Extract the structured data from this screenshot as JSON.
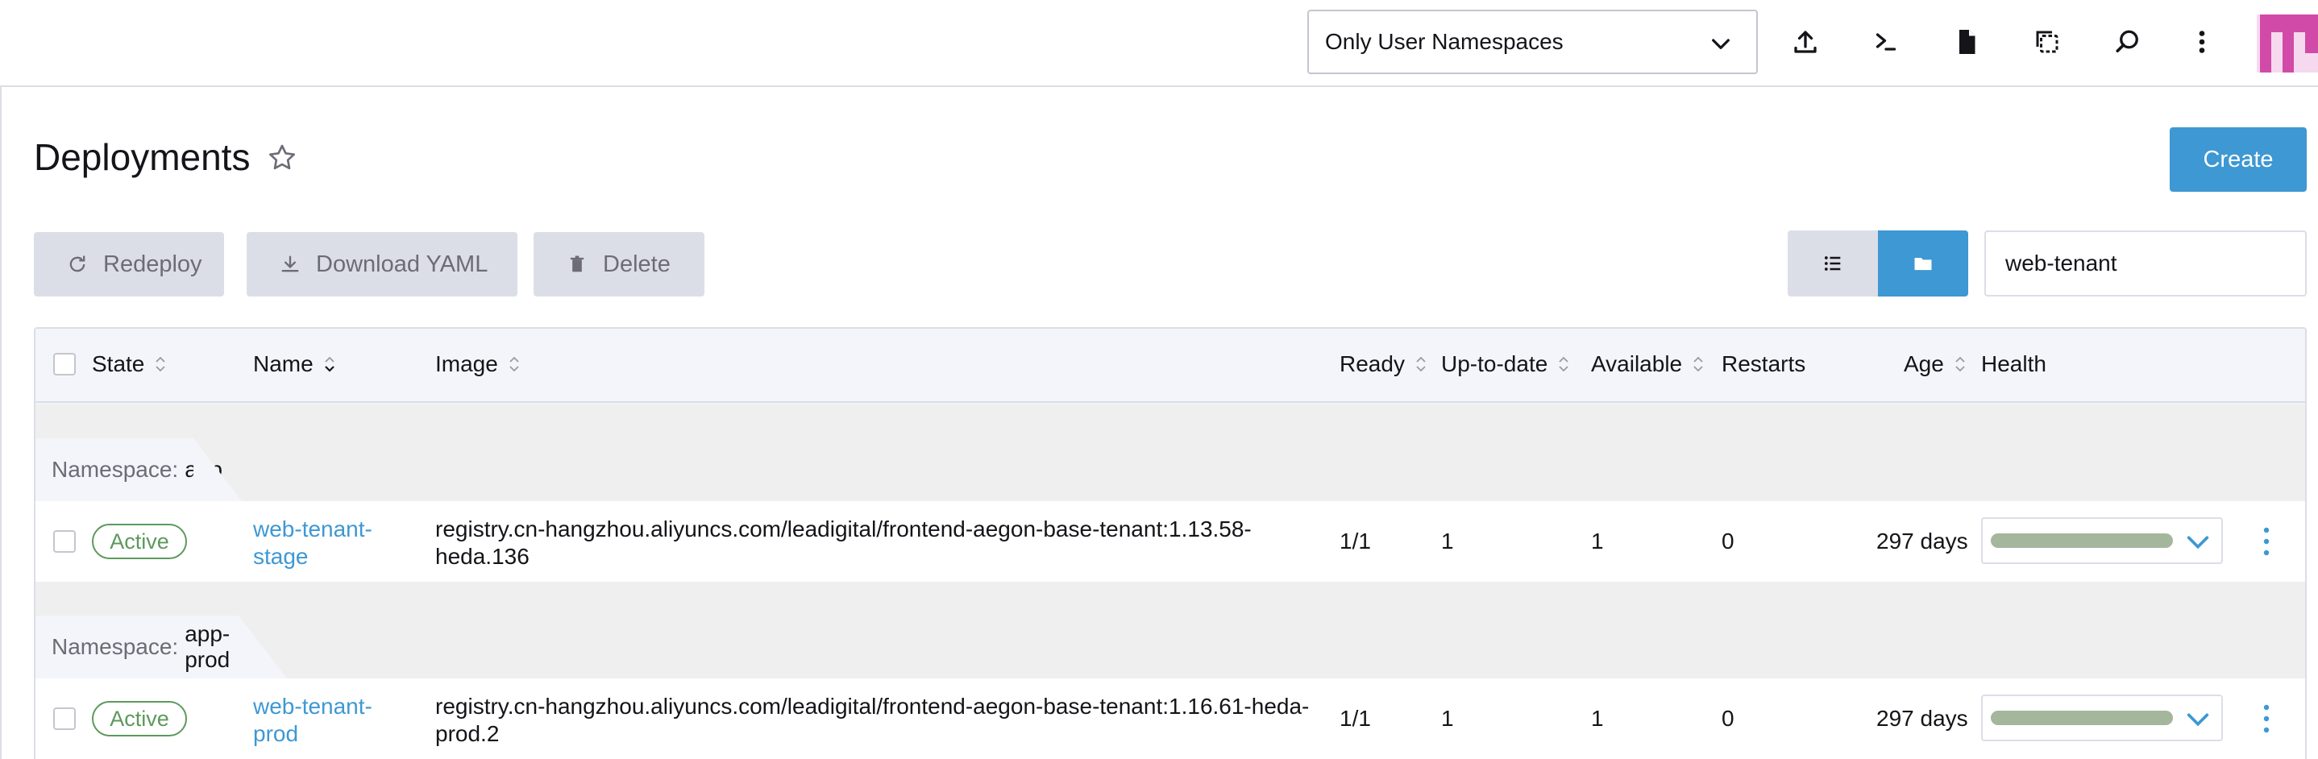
{
  "header": {
    "namespace_filter": "Only User Namespaces",
    "icons": [
      "upload-icon",
      "terminal-icon",
      "file-icon",
      "copy-config-icon",
      "search-icon",
      "more-vertical-icon"
    ]
  },
  "page": {
    "title": "Deployments",
    "create_label": "Create"
  },
  "toolbar": {
    "redeploy_label": "Redeploy",
    "download_label": "Download YAML",
    "delete_label": "Delete",
    "search_value": "web-tenant"
  },
  "table": {
    "columns": {
      "state": "State",
      "name": "Name",
      "image": "Image",
      "ready": "Ready",
      "uptodate": "Up-to-date",
      "available": "Available",
      "restarts": "Restarts",
      "age": "Age",
      "health": "Health"
    },
    "groups": [
      {
        "label": "Namespace:",
        "namespace": "app",
        "row": {
          "state": "Active",
          "name_line1": "web-tenant-",
          "name_line2": "stage",
          "image_line1": "registry.cn-hangzhou.aliyuncs.com/leadigital/frontend-aegon-base-tenant:1.13.58-",
          "image_line2": "heda.136",
          "ready": "1/1",
          "uptodate": "1",
          "available": "1",
          "restarts": "0",
          "age": "297 days"
        }
      },
      {
        "label": "Namespace:",
        "namespace": "app-prod",
        "row": {
          "state": "Active",
          "name_line1": "web-tenant-",
          "name_line2": "prod",
          "image_line1": "registry.cn-hangzhou.aliyuncs.com/leadigital/frontend-aegon-base-tenant:1.16.61-heda-",
          "image_line2": "prod.2",
          "ready": "1/1",
          "uptodate": "1",
          "available": "1",
          "restarts": "0",
          "age": "297 days"
        }
      }
    ]
  },
  "colors": {
    "accent": "#3d98d3",
    "active_green": "#5d995d",
    "health_bar": "#a4b79d",
    "button_grey": "#dcdee7",
    "brand_magenta": "#d14aa8"
  }
}
